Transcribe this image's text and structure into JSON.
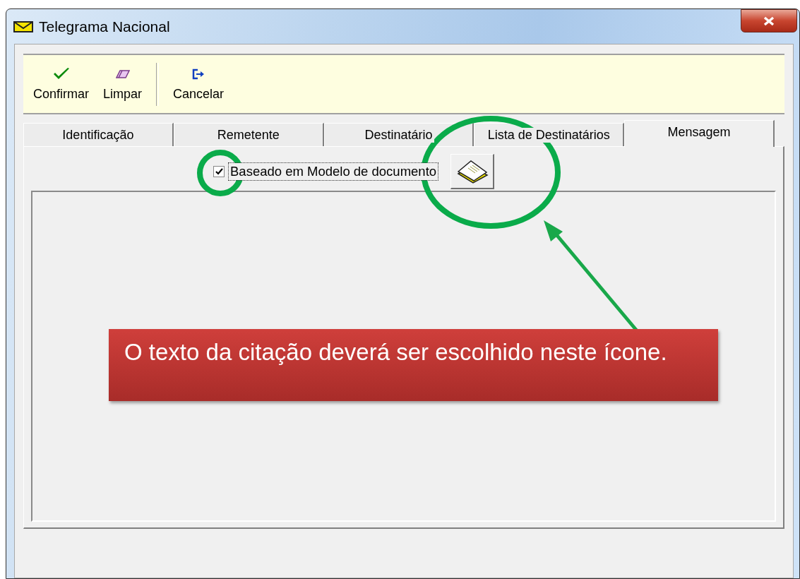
{
  "window": {
    "title": "Telegrama Nacional"
  },
  "toolbar": [
    {
      "label": "Confirmar",
      "kind": "confirm",
      "separator_before": false
    },
    {
      "label": "Limpar",
      "kind": "clear",
      "separator_before": false
    },
    {
      "label": "Cancelar",
      "kind": "cancel",
      "separator_before": true
    }
  ],
  "tabs": [
    {
      "label": "Identificação",
      "selected": false
    },
    {
      "label": "Remetente",
      "selected": false
    },
    {
      "label": "Destinatário",
      "selected": false
    },
    {
      "label": "Lista de Destinatários",
      "selected": false
    },
    {
      "label": "Mensagem",
      "selected": true
    }
  ],
  "message": {
    "template_checkbox": {
      "label": "Baseado em Modelo de documento",
      "checked": true
    }
  },
  "annotation": {
    "callout": "O texto da citação deverá ser escolhido neste ícone."
  }
}
